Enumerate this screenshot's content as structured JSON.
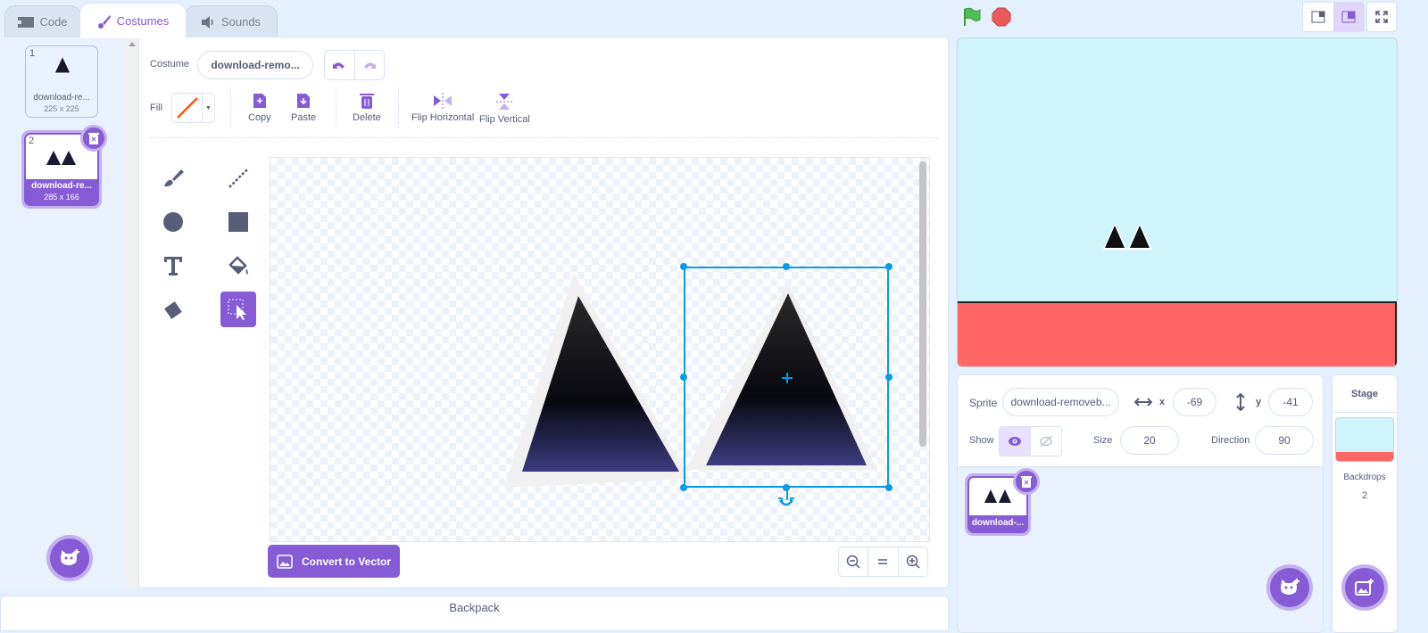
{
  "tabs": [
    {
      "label": "Code",
      "icon": "code-icon"
    },
    {
      "label": "Costumes",
      "icon": "brush-icon"
    },
    {
      "label": "Sounds",
      "icon": "speaker-icon"
    }
  ],
  "active_tab": "Costumes",
  "costumes": [
    {
      "number": "1",
      "name": "download-re...",
      "size": "225 x 225"
    },
    {
      "number": "2",
      "name": "download-re...",
      "size": "285 x 166",
      "selected": true
    }
  ],
  "editor": {
    "costume_label": "Costume",
    "costume_name": "download-remo...",
    "fill_label": "Fill",
    "toolbar": {
      "copy": "Copy",
      "paste": "Paste",
      "delete": "Delete",
      "flip_h": "Flip Horizontal",
      "flip_v": "Flip Vertical"
    },
    "tools": [
      "brush",
      "line",
      "circle",
      "rectangle",
      "text",
      "fill",
      "eraser",
      "select"
    ],
    "active_tool": "select",
    "convert_label": "Convert to Vector",
    "zoom_buttons": [
      "zoom-out",
      "reset",
      "zoom-in"
    ]
  },
  "backpack_label": "Backpack",
  "sprite": {
    "label": "Sprite",
    "name": "download-removeb...",
    "x_label": "x",
    "x": "-69",
    "y_label": "y",
    "y": "-41",
    "show_label": "Show",
    "size_label": "Size",
    "size": "20",
    "direction_label": "Direction",
    "direction": "90",
    "visible": true
  },
  "sprite_list": [
    {
      "name": "download-..."
    }
  ],
  "stage_panel": {
    "title": "Stage",
    "backdrops_label": "Backdrops",
    "backdrops_count": "2"
  },
  "colors": {
    "accent": "#855cd6",
    "sky": "#d0f4fc",
    "floor": "#ff6666",
    "selection": "#0a9be6"
  }
}
